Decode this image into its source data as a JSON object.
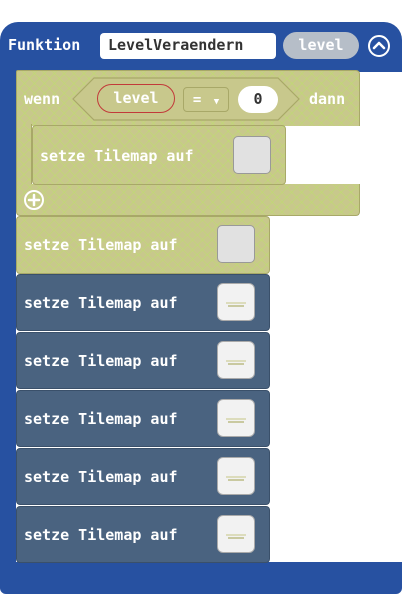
{
  "function": {
    "keyword": "Funktion",
    "name": "LevelVeraendern",
    "parameter": "level"
  },
  "if_block": {
    "if_label": "wenn",
    "then_label": "dann",
    "variable": "level",
    "operator": "=",
    "value": "0"
  },
  "block_label": "setze Tilemap auf",
  "colors": {
    "function_blue": "#2751a1",
    "disabled_olive": "#c8c88c",
    "enabled_block": "#4a6380"
  }
}
